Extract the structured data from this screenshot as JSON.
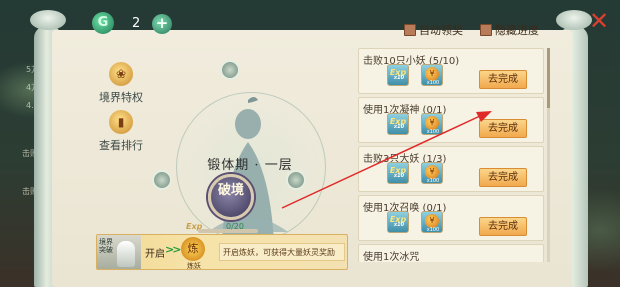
{
  "header": {
    "jade_icon_glyph": "G",
    "jade_count": "2",
    "plus_glyph": "+",
    "auto_claim_label": "自动领奖",
    "hide_progress_label": "隐藏进度",
    "close_glyph": "✕"
  },
  "side_buttons": [
    {
      "label": "境界特权",
      "icon": "lotus-icon",
      "glyph": "❀"
    },
    {
      "label": "查看排行",
      "icon": "ranking-icon",
      "glyph": "▮"
    }
  ],
  "realm": {
    "title": "锻体期 · 一层",
    "button_label": "破境",
    "exp_label": "Exp",
    "exp_progress": "0/20",
    "exp_fraction": 0.0
  },
  "banner": {
    "left_text": "境界突破",
    "open_label": "开启",
    "arrows": ">>",
    "lantern_glyph": "炼",
    "refine_label": "炼妖",
    "description": "开启炼妖，可获得大量妖灵奖励"
  },
  "tasks": [
    {
      "title": "击败10只小妖 (5/10)",
      "button": "去完成",
      "rewards": [
        {
          "type": "exp",
          "label": "Exp",
          "qty": "x10"
        },
        {
          "type": "coin",
          "label": "¥",
          "qty": "x100"
        }
      ]
    },
    {
      "title": "使用1次凝神 (0/1)",
      "button": "去完成",
      "rewards": [
        {
          "type": "exp",
          "label": "Exp",
          "qty": "x10"
        },
        {
          "type": "coin",
          "label": "¥",
          "qty": "x100"
        }
      ]
    },
    {
      "title": "击败3只大妖 (1/3)",
      "button": "去完成",
      "rewards": [
        {
          "type": "exp",
          "label": "Exp",
          "qty": "x10"
        },
        {
          "type": "coin",
          "label": "¥",
          "qty": "x100"
        }
      ]
    },
    {
      "title": "使用1次召唤 (0/1)",
      "button": "去完成",
      "rewards": [
        {
          "type": "exp",
          "label": "Exp",
          "qty": "x10"
        },
        {
          "type": "coin",
          "label": "¥",
          "qty": "x100"
        }
      ]
    },
    {
      "title": "使用1次冰咒",
      "button": "去完成",
      "rewards": []
    }
  ],
  "background": {
    "left_texts": [
      "5万敌",
      "4万敌",
      "4.5万",
      "击败",
      "击败"
    ]
  },
  "colors": {
    "accent_button": "#f1a94d",
    "panel": "#f1ecdd",
    "arrow_red": "#e02a2a"
  }
}
